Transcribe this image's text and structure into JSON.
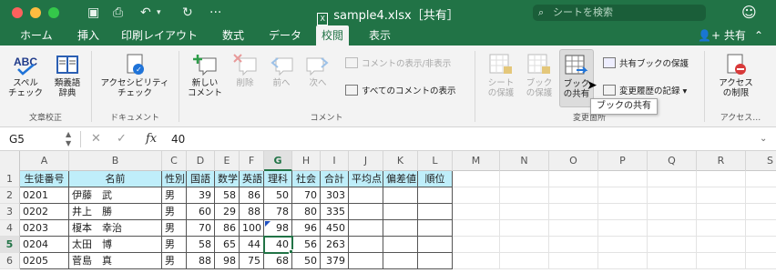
{
  "window": {
    "title": "sample4.xlsx［共有］",
    "search_placeholder": "シートを検索"
  },
  "ribbon_tabs": [
    "ホーム",
    "挿入",
    "印刷レイアウト",
    "数式",
    "データ",
    "校閲",
    "表示"
  ],
  "active_tab": "校閲",
  "share_label": "共有",
  "groups": {
    "proofing": {
      "label": "文章校正",
      "spelling": "スペル\nチェック",
      "thesaurus": "類義語\n辞典"
    },
    "document": {
      "label": "ドキュメント",
      "accessibility": "アクセシビリティ\nチェック"
    },
    "comments": {
      "label": "コメント",
      "new_comment": "新しい\nコメント",
      "delete": "削除",
      "previous": "前へ",
      "next": "次へ",
      "show_hide": "コメントの表示/非表示",
      "show_all": "すべてのコメントの表示"
    },
    "changes": {
      "label": "変更箇所",
      "protect_sheet": "シート\nの保護",
      "protect_workbook": "ブック\nの保護",
      "share_workbook": "ブック\nの共有",
      "protect_shared": "共有ブックの保護",
      "track_changes": "変更履歴の記録"
    },
    "access": {
      "label": "アクセス…",
      "restrict": "アクセス\nの制限"
    }
  },
  "tooltip": "ブックの共有",
  "formula_bar": {
    "name_box": "G5",
    "value": "40"
  },
  "sheet": {
    "columns": [
      "A",
      "B",
      "C",
      "D",
      "E",
      "F",
      "G",
      "H",
      "I",
      "J",
      "K",
      "L",
      "M",
      "N",
      "O",
      "P",
      "Q",
      "R",
      "S"
    ],
    "selected_column": "G",
    "selected_row": "5",
    "row_numbers": [
      "1",
      "2",
      "3",
      "4",
      "5",
      "6"
    ],
    "header_row": [
      "生徒番号",
      "名前",
      "性別",
      "国語",
      "数学",
      "英語",
      "理科",
      "社会",
      "合計",
      "平均点",
      "偏差値",
      "順位"
    ],
    "rows": [
      [
        "0201",
        "伊藤　武",
        "男",
        "39",
        "58",
        "86",
        "50",
        "70",
        "303",
        "",
        "",
        ""
      ],
      [
        "0202",
        "井上　勝",
        "男",
        "60",
        "29",
        "88",
        "78",
        "80",
        "335",
        "",
        "",
        ""
      ],
      [
        "0203",
        "榎本　幸治",
        "男",
        "70",
        "86",
        "100",
        "98",
        "96",
        "450",
        "",
        "",
        ""
      ],
      [
        "0204",
        "太田　博",
        "男",
        "58",
        "65",
        "44",
        "40",
        "56",
        "263",
        "",
        "",
        ""
      ],
      [
        "0205",
        "菅島　真",
        "男",
        "88",
        "98",
        "75",
        "68",
        "50",
        "379",
        "",
        "",
        ""
      ]
    ]
  },
  "colors": {
    "excel_green": "#217346",
    "header_fill": "#bfeefa"
  }
}
